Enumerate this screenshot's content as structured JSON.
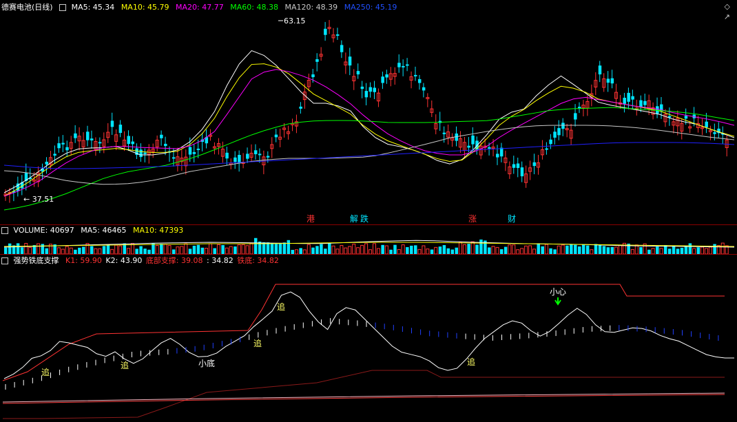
{
  "main_pane": {
    "title": "德赛电池(日线)",
    "indicators": [
      {
        "label": "MA5: 45.34",
        "color": "#ffffff"
      },
      {
        "label": "MA10: 45.79",
        "color": "#ffff00"
      },
      {
        "label": "MA20: 47.77",
        "color": "#ff00ff"
      },
      {
        "label": "MA60: 48.38",
        "color": "#00ff00"
      },
      {
        "label": "MA120: 48.39",
        "color": "#c8c8c8"
      },
      {
        "label": "MA250: 45.19",
        "color": "#0000ff"
      }
    ],
    "high_label": "63.15",
    "low_label": "37.51",
    "events": [
      {
        "text": "港",
        "color": "#ff3333"
      },
      {
        "text": "解",
        "color": "#00e5ff"
      },
      {
        "text": "跌",
        "color": "#00e5ff"
      },
      {
        "text": "涨",
        "color": "#ff3333"
      },
      {
        "text": "财",
        "color": "#00e5ff"
      }
    ]
  },
  "volume_pane": {
    "labels": [
      {
        "label": "VOLUME: 40697",
        "color": "#ffffff"
      },
      {
        "label": "MA5: 46465",
        "color": "#ffffff"
      },
      {
        "label": "MA10: 47393",
        "color": "#ffff00"
      }
    ]
  },
  "indicator_pane": {
    "title": "强势铁底支撑",
    "labels": [
      {
        "label": "K1: 59.90",
        "color": "#ff3333"
      },
      {
        "label": "K2: 43.90",
        "color": "#ffffff"
      },
      {
        "label": "底部支撑: 39.08",
        "color": "#ff3333"
      },
      {
        "label": ": 34.82",
        "color": "#ffffff"
      },
      {
        "label": "铁底: 34.82",
        "color": "#ff3333"
      }
    ],
    "signals": [
      {
        "text": "追"
      },
      {
        "text": "追"
      },
      {
        "text": "追"
      },
      {
        "text": "追"
      },
      {
        "text": "追"
      }
    ],
    "note_bottom": "小底",
    "warning": "小心"
  },
  "icons": [
    "diamond-icon",
    "arrow-icon"
  ],
  "colors": {
    "up": "#ff3333",
    "down": "#00e5ff",
    "grid": "#8b0000"
  }
}
